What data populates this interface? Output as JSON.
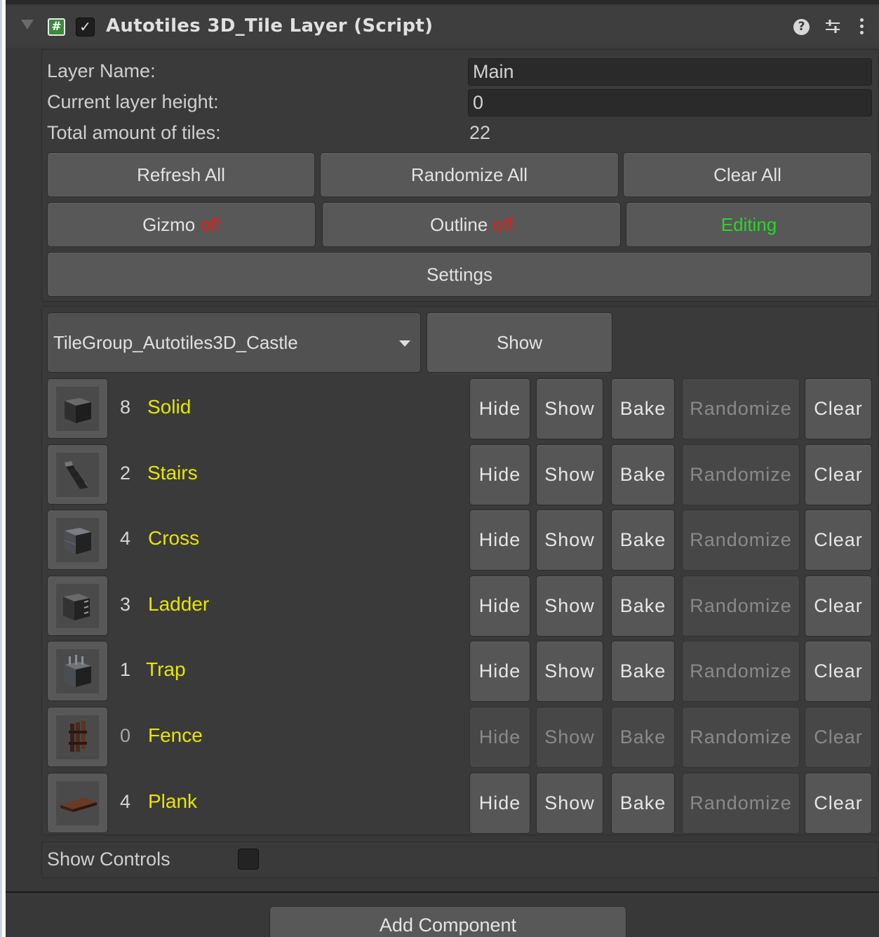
{
  "component": {
    "title": "Autotiles 3D_Tile Layer (Script)",
    "enabled": true
  },
  "fields": {
    "layer_name_label": "Layer Name:",
    "layer_name_value": "Main",
    "layer_height_label": "Current layer height:",
    "layer_height_value": "0",
    "total_tiles_label": "Total amount of tiles:",
    "total_tiles_value": "22"
  },
  "buttons": {
    "refresh_all": "Refresh All",
    "randomize_all": "Randomize All",
    "clear_all": "Clear All",
    "gizmo": "Gizmo",
    "gizmo_state": "off",
    "outline": "Outline",
    "outline_state": "off",
    "editing": "Editing",
    "settings": "Settings"
  },
  "tile_group": {
    "selected": "TileGroup_Autotiles3D_Castle",
    "show_label": "Show"
  },
  "tiles": [
    {
      "count": "8",
      "name": "Solid",
      "icon": "solid-cube-icon"
    },
    {
      "count": "2",
      "name": "Stairs",
      "icon": "stairs-icon"
    },
    {
      "count": "4",
      "name": "Cross",
      "icon": "cross-block-icon"
    },
    {
      "count": "3",
      "name": "Ladder",
      "icon": "ladder-block-icon"
    },
    {
      "count": "1",
      "name": "Trap",
      "icon": "trap-block-icon"
    },
    {
      "count": "0",
      "name": "Fence",
      "icon": "fence-icon"
    },
    {
      "count": "4",
      "name": "Plank",
      "icon": "plank-icon"
    }
  ],
  "tile_actions": {
    "hide": "Hide",
    "show": "Show",
    "bake": "Bake",
    "randomize": "Randomize",
    "clear": "Clear"
  },
  "controls": {
    "show_controls_label": "Show Controls",
    "show_controls_checked": false
  },
  "add_component": "Add Component",
  "colors": {
    "tile_name": "#e6e600",
    "state_off": "#e81a1a",
    "state_editing": "#27d727"
  }
}
